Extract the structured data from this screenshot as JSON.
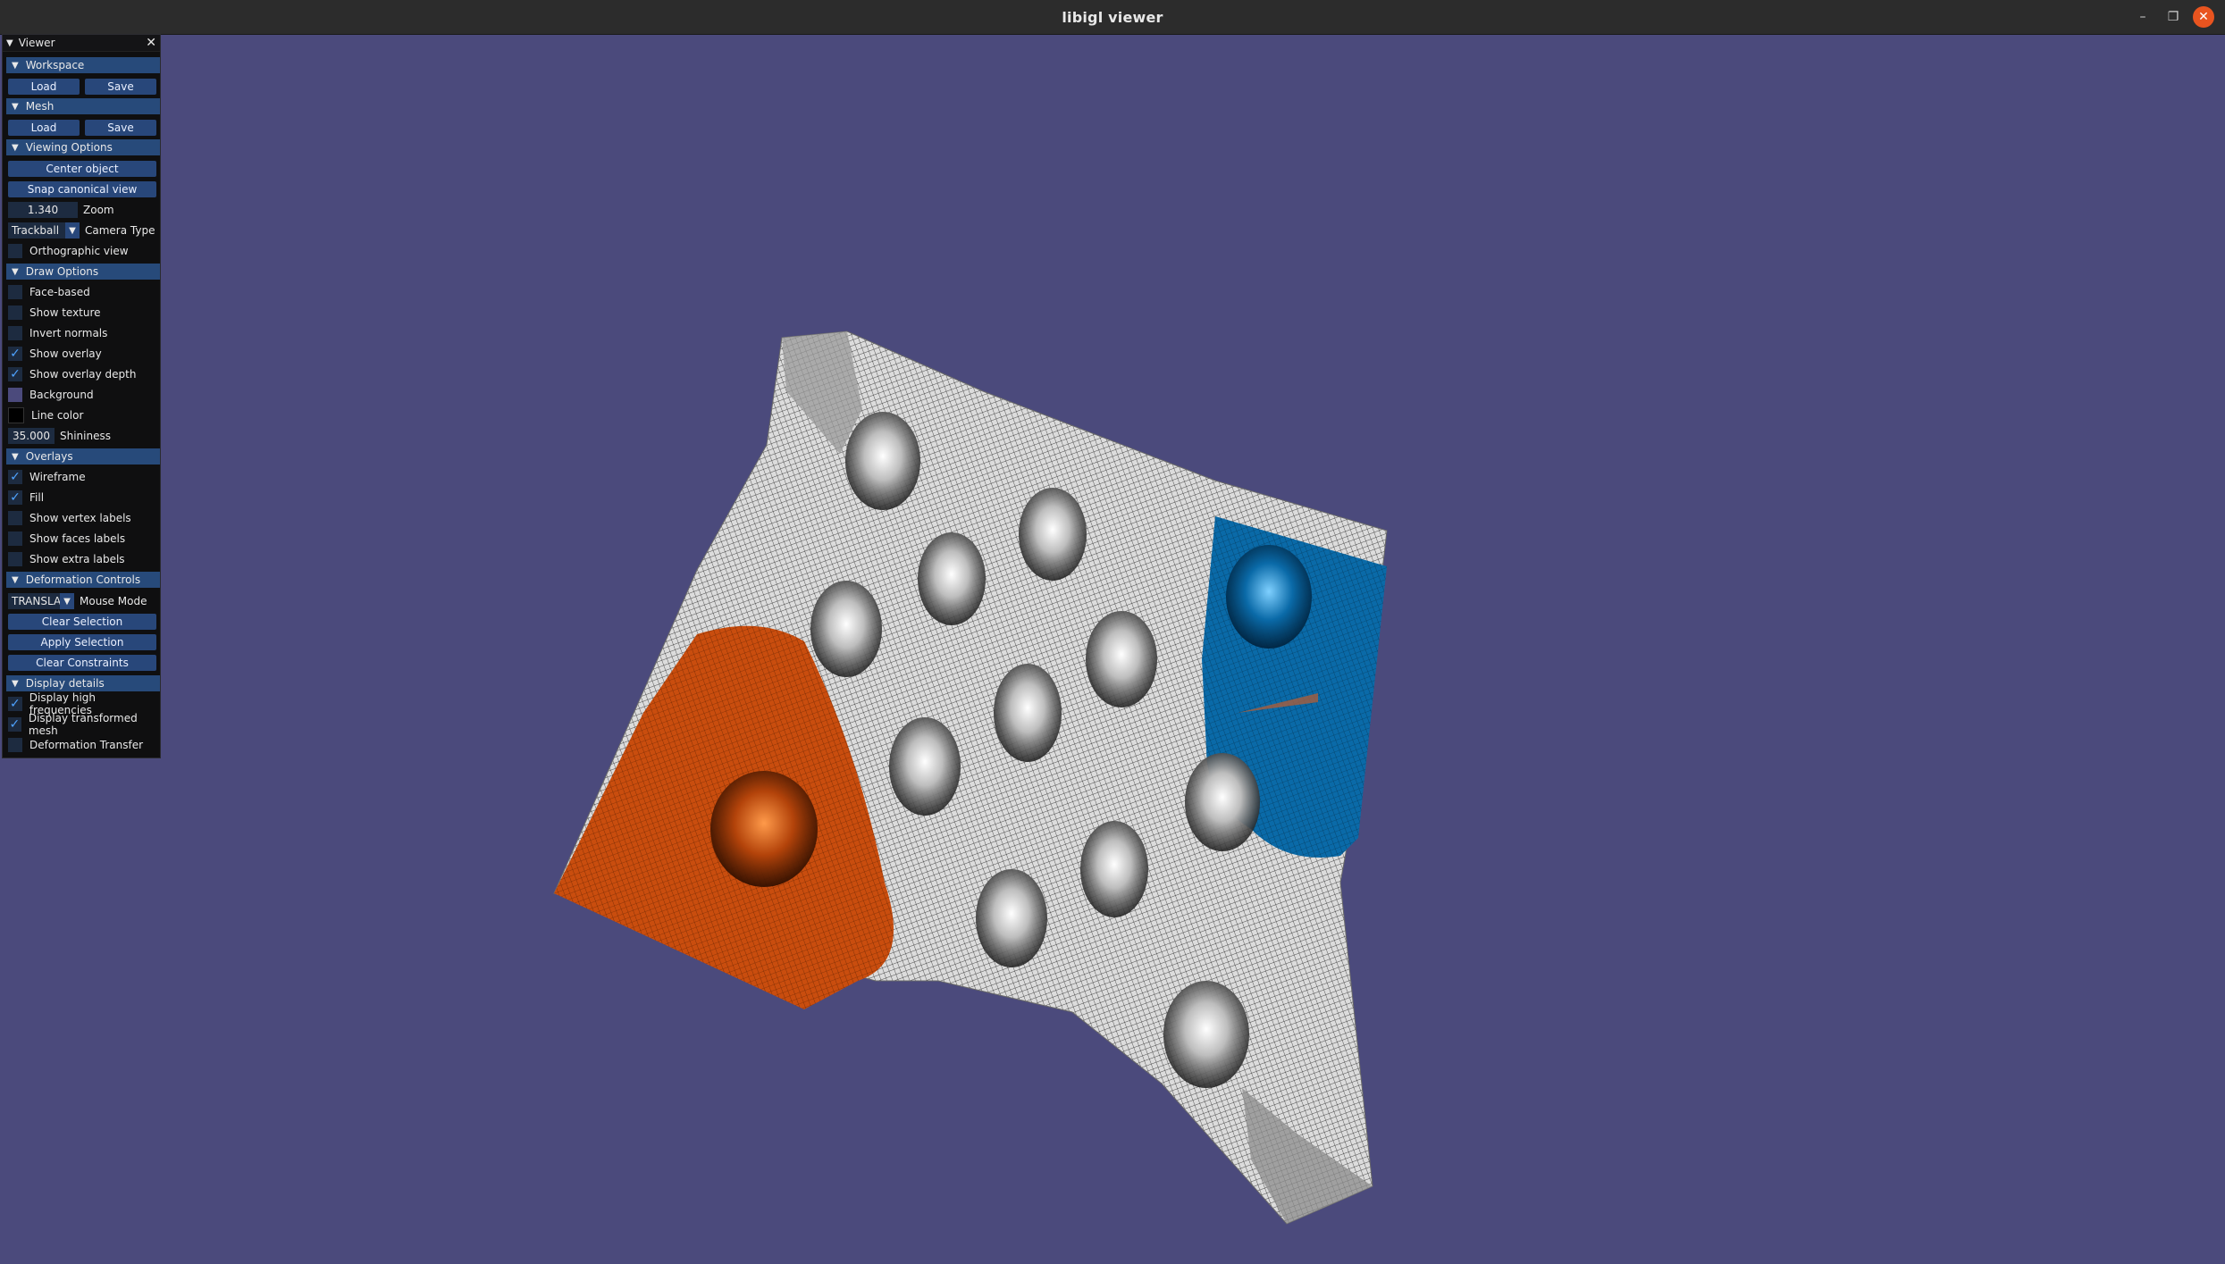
{
  "window": {
    "title": "libigl viewer",
    "controls": [
      "minimize-icon",
      "maximize-icon",
      "close-icon"
    ]
  },
  "colors": {
    "background": "#4b4a7c",
    "header": "#274a7a",
    "button": "#28477a",
    "check": "#4fa3ff",
    "orange_region": "#c94d0e",
    "blue_region": "#0a6aa8"
  },
  "panel": {
    "title": "Viewer",
    "workspace": {
      "header": "Workspace",
      "load": "Load",
      "save": "Save"
    },
    "mesh": {
      "header": "Mesh",
      "load": "Load",
      "save": "Save"
    },
    "viewing": {
      "header": "Viewing Options",
      "center": "Center object",
      "snap": "Snap canonical view",
      "zoom_value": "1.340",
      "zoom_label": "Zoom",
      "camera_value": "Trackball",
      "camera_label": "Camera Type",
      "ortho": "Orthographic view"
    },
    "draw": {
      "header": "Draw Options",
      "face_based": "Face-based",
      "show_texture": "Show texture",
      "invert_normals": "Invert normals",
      "show_overlay": "Show overlay",
      "show_overlay_depth": "Show overlay depth",
      "background": "Background",
      "line_color": "Line color",
      "shininess_value": "35.000",
      "shininess_label": "Shininess"
    },
    "overlays": {
      "header": "Overlays",
      "wireframe": "Wireframe",
      "fill": "Fill",
      "vertex_labels": "Show vertex labels",
      "faces_labels": "Show faces labels",
      "extra_labels": "Show extra labels"
    },
    "deformation": {
      "header": "Deformation Controls",
      "mode_value": "TRANSLAT",
      "mode_label": "Mouse Mode",
      "clear_selection": "Clear Selection",
      "apply_selection": "Apply Selection",
      "clear_constraints": "Clear Constraints"
    },
    "display": {
      "header": "Display details",
      "high_freq": "Display high frequencies",
      "transformed": "Display transformed mesh",
      "transfer": "Deformation Transfer"
    }
  }
}
